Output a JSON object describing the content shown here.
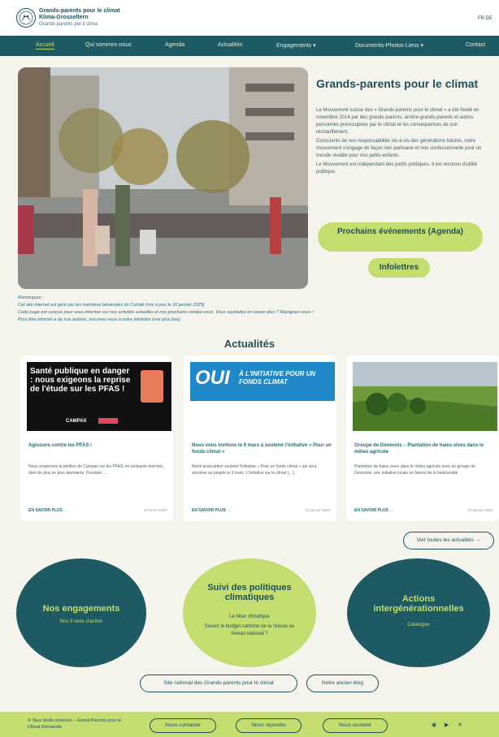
{
  "header": {
    "logo_line1": "Grands-parents pour le climat",
    "logo_line2": "Klima-Grosseltern",
    "logo_line3": "Grands-parents per il clima",
    "lang": "FR DE"
  },
  "nav": {
    "items": [
      {
        "label": "Accueil"
      },
      {
        "label": "Qui sommes-nous"
      },
      {
        "label": "Agenda"
      },
      {
        "label": "Actualités"
      },
      {
        "label": "Engagements ▾"
      },
      {
        "label": "Documents-Photos-Liens ▾"
      },
      {
        "label": "Contact"
      }
    ]
  },
  "hero": {
    "title": "Grands-parents pour le climat",
    "para1": "Le Mouvement suisse des « Grands-parents pour le climat » a été fondé en novembre 2014 par des grands-parents, arrière-grands-parents et autres personnes préoccupées par le climat et les conséquences de son réchauffement.",
    "para2": "Conscients de nos responsabilités vis-à-vis des générations futures, notre mouvement s'engage de façon non partisane et non confessionnelle pour un monde vivable pour nos petits-enfants.",
    "para3": "Le Mouvement est indépendant des partis politiques. Il est reconnu d'utilité publique.",
    "events_button": "Prochains événements (Agenda)",
    "news_button": "Infolettres"
  },
  "remarks": {
    "title": "Remarques :",
    "line1": "Cet site internet est géré par les membres bénévoles du Comité (mis à jour le 20 janvier 2025)",
    "line2": "Cette page est conçue pour vous informer sur nos activités actuelles et nos prochains rendez-vous. Vous souhaitez en savoir plus ? Rejoignez-nous !",
    "line3": "Pour être informé·e de nos actions, inscrivez-vous à notre infolettre (voir plus bas)."
  },
  "news": {
    "section_title": "Actualités",
    "cards": [
      {
        "image_text": "Santé publique en danger : nous exigeons la reprise de l'étude sur les PFAS !",
        "image_brand": "CAMPAX",
        "title": "Agissons contre les PFAS !",
        "excerpt": "Nous soutenons la pétition de Campax sur les PFAS, en polluants éternels, dont de plus en plus alarmants. Pourtant, …",
        "more": "EN SAVOIR PLUS →",
        "date": "6 février 2025"
      },
      {
        "image_text_big": "OUI",
        "image_text_small": "À L'INITIATIVE POUR UN FONDS CLIMAT",
        "title": "Nous vous invitons le 9 mars à soutenir l'initiative « Pour un fonds climat »",
        "excerpt": "Notre association soutient l'initiative « Pour un fonds climat » qui sera soumise au peuple le 9 mars. L'initiative sur le climat […]",
        "more": "EN SAVOIR PLUS →",
        "date": "31 janvier 2025"
      },
      {
        "title": "Groupe de Genevois – Plantation de haies vives dans le milieu agricole",
        "excerpt": "Plantation de haies vives dans le milieu agricole avec un groupe de Genevois, une initiative locale en faveur de la biodiversité",
        "more": "EN SAVOIR PLUS →",
        "date": "20 janvier 2025"
      }
    ],
    "all_news_button": "Voir toutes les actualités →"
  },
  "circles": {
    "engagements_title": "Nos engagements",
    "engagements_sub": "Nos 9 axes d'action",
    "politics_title": "Suivi des politiques climatiques",
    "politics_sub1": "Le bilan climatique",
    "politics_sub2": "Suivez le budget carbone de la Suisse au niveau national ?",
    "actions_title": "Actions intergénérationnelles",
    "actions_sub": "Catalogue"
  },
  "links": {
    "national_site": "Site national des Grands-parents pour le climat",
    "blog": "Notre ancien blog"
  },
  "footer": {
    "copyright": "© Tous droits réservés – Grand-Parents pour le Climat Romandie",
    "contact": "Nous contacter",
    "join": "Nous rejoindre",
    "support": "Nous soutenir"
  },
  "colors": {
    "primary": "#1e5a64",
    "accent": "#c3dd6e",
    "background": "#f4f4ec"
  }
}
